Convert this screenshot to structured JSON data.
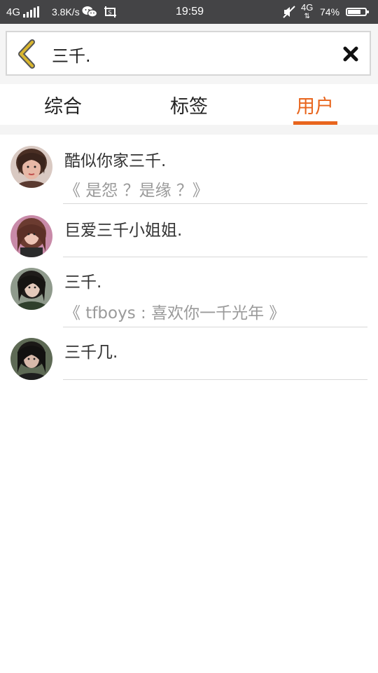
{
  "status_bar": {
    "network_left": "4G",
    "speed": "3.8K/s",
    "time": "19:59",
    "network_right": "4G",
    "battery": "74%",
    "battery_level": 0.74,
    "icons": [
      "signal-bars-icon",
      "wechat-icon",
      "screenshot-icon",
      "mute-icon",
      "data-arrows-icon",
      "battery-icon"
    ]
  },
  "search": {
    "query": "三千.",
    "back_icon": "chevron-left-icon",
    "clear_icon": "close-icon"
  },
  "tabs": [
    {
      "label": "综合",
      "active": false
    },
    {
      "label": "标签",
      "active": false
    },
    {
      "label": "用户",
      "active": true
    }
  ],
  "colors": {
    "accent": "#e8651d",
    "status_bar_bg": "#444446",
    "secondary_text": "#9a9a9a",
    "back_icon": "#d9b62e"
  },
  "users": [
    {
      "name": "酷似你家三千.",
      "signature": "《 是怨 ？是缘 ？》"
    },
    {
      "name": "巨爱三千小姐姐.",
      "signature": ""
    },
    {
      "name": "三千.",
      "signature": "《 tfboys : 喜欢你一千光年 》"
    },
    {
      "name": "三千几.",
      "signature": ""
    }
  ]
}
